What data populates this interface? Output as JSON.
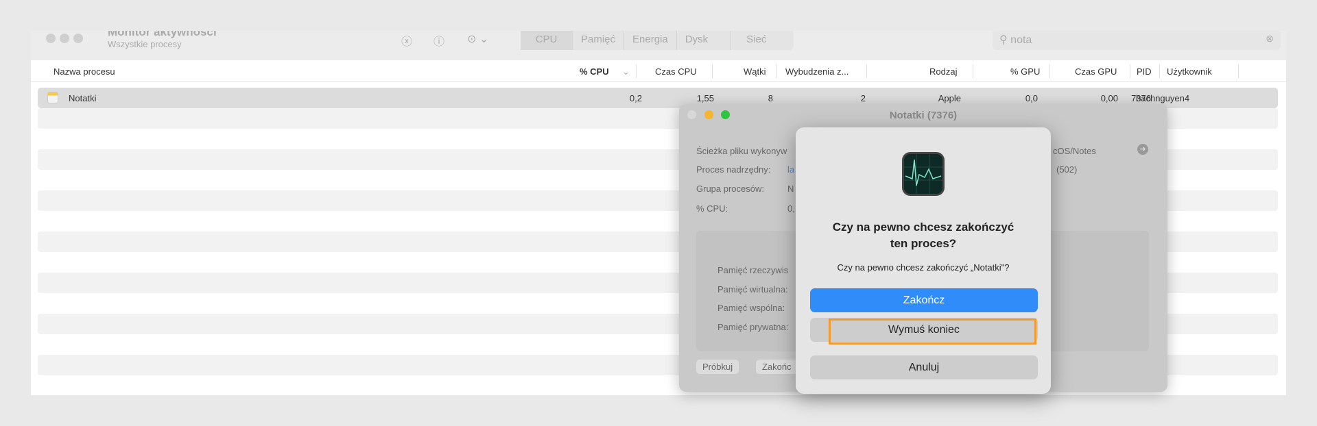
{
  "app": {
    "title": "Monitor aktywności",
    "subtitle": "Wszystkie procesy"
  },
  "toolbar": {
    "stop_icon": "x-circle-icon",
    "info_icon": "info-circle-icon",
    "more_icon": "ellipsis-circle-icon",
    "tabs": [
      "CPU",
      "Pamięć",
      "Energia",
      "Dysk",
      "Sieć"
    ],
    "search_value": "nota"
  },
  "columns": [
    "Nazwa procesu",
    "% CPU",
    "Czas CPU",
    "Wątki",
    "Wybudzenia z...",
    "Rodzaj",
    "% GPU",
    "Czas GPU",
    "PID",
    "Użytkownik"
  ],
  "row": {
    "name": "Notatki",
    "cpu": "0,2",
    "cpu_time": "1,55",
    "threads": "8",
    "wakeups": "2",
    "kind": "Apple",
    "gpu": "0,0",
    "gpu_time": "0,00",
    "pid": "7376",
    "user": "bachnguyen4"
  },
  "info": {
    "title": "Notatki (7376)",
    "path_label": "Ścieżka pliku wykonyw",
    "path_value": "cOS/Notes",
    "parent_label": "Proces nadrzędny:",
    "parent_value": "la",
    "parent_pid": "(502)",
    "group_label": "Grupa procesów:",
    "group_value": "N",
    "cpu_label": "% CPU:",
    "cpu_value": "0,",
    "mem": [
      "Pamięć rzeczywis",
      "Pamięć wirtualna:",
      "Pamięć wspólna:",
      "Pamięć prywatna:"
    ],
    "sample_btn": "Próbkuj",
    "quit_btn": "Zakońc"
  },
  "dialog": {
    "title": "Czy na pewno chcesz zakończyć ten proces?",
    "message": "Czy na pewno chcesz zakończyć „Notatki\"?",
    "quit": "Zakończ",
    "force_quit": "Wymuś koniec",
    "cancel": "Anuluj"
  },
  "colors": {
    "accent": "#2f8cf8",
    "highlight": "#f29a2e"
  }
}
